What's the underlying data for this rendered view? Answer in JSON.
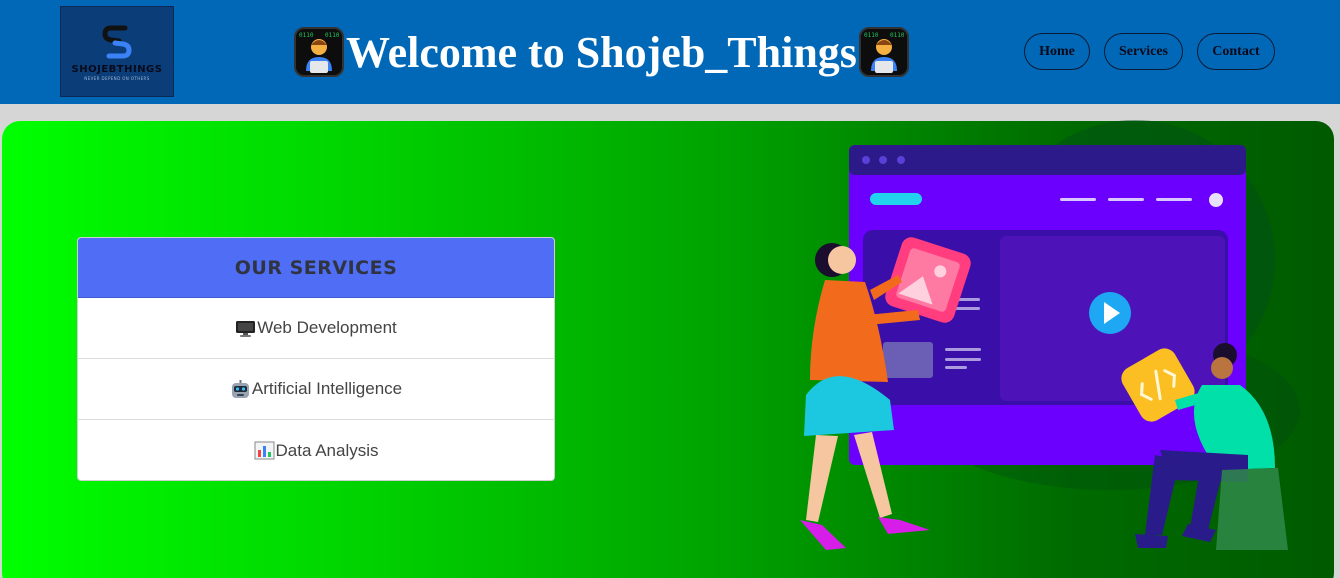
{
  "header": {
    "logo": {
      "name": "SHOJEBTHINGS",
      "tagline": "NEVER DEPEND ON OTHERS"
    },
    "title": "Welcome to Shojeb_Things",
    "title_emoji": "technologist-icon",
    "nav": [
      {
        "label": "Home"
      },
      {
        "label": "Services"
      },
      {
        "label": "Contact"
      }
    ]
  },
  "services": {
    "title": "OUR SERVICES",
    "items": [
      {
        "label": "Web Development",
        "icon": "desktop-computer-icon"
      },
      {
        "label": "Artificial Intelligence",
        "icon": "robot-icon"
      },
      {
        "label": "Data Analysis",
        "icon": "bar-chart-icon"
      }
    ]
  },
  "colors": {
    "header_bg": "#0068b7",
    "services_head_bg": "#4f6ef5",
    "hero_gradient_start": "#00ff00",
    "hero_gradient_end": "#005a00",
    "browser_purple": "#6b00ff"
  }
}
